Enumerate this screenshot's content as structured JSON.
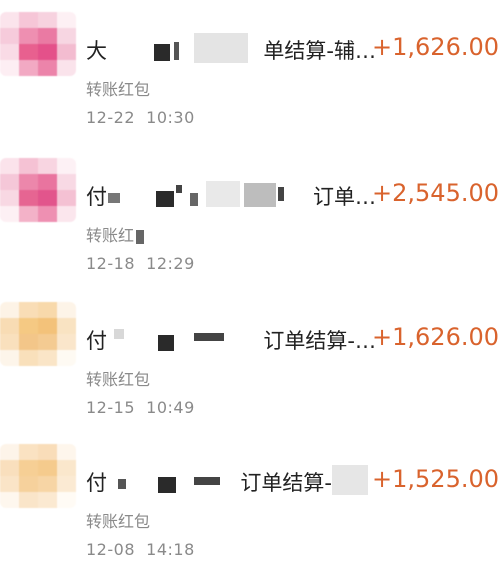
{
  "transactions": [
    {
      "title_lead": "大",
      "title_tail": "单结算-辅…",
      "subtitle": "转账红包",
      "date": "12-22",
      "time": "10:30",
      "amount": "+1,626.00",
      "avatar_palette": "pink"
    },
    {
      "title_lead": "付",
      "title_tail": "订单…",
      "subtitle": "转账红",
      "date": "12-18",
      "time": "12:29",
      "amount": "+2,545.00",
      "avatar_palette": "pink"
    },
    {
      "title_lead": "付",
      "title_tail": "订单结算-…",
      "subtitle": "转账红包",
      "date": "12-15",
      "time": "10:49",
      "amount": "+1,626.00",
      "avatar_palette": "peach"
    },
    {
      "title_lead": "付",
      "title_tail": "订单结算-",
      "subtitle": "转账红包",
      "date": "12-08",
      "time": "14:18",
      "amount": "+1,525.00",
      "avatar_palette": "peach"
    }
  ],
  "colors": {
    "amount": "#d9632d",
    "title": "#222222",
    "meta": "#8a8a8a"
  }
}
